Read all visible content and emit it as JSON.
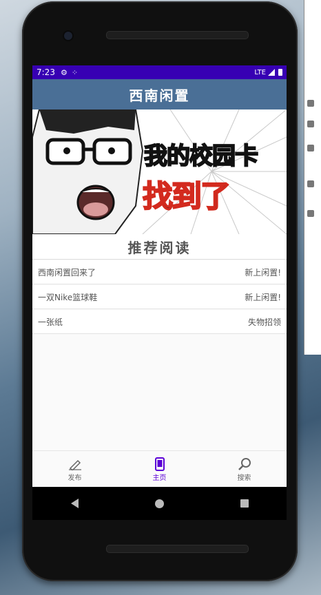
{
  "status_bar": {
    "time": "7:23",
    "network": "LTE"
  },
  "app_bar": {
    "title": "西南闲置"
  },
  "banner": {
    "line1": "我的校园卡",
    "line2": "找到了"
  },
  "section": {
    "title": "推荐阅读"
  },
  "items": [
    {
      "title": "西南闲置回来了",
      "tag": "新上闲置!"
    },
    {
      "title": "一双Nike篮球鞋",
      "tag": "新上闲置!"
    },
    {
      "title": "一张纸",
      "tag": "失物招领"
    }
  ],
  "bottom_nav": [
    {
      "label": "发布",
      "icon": "pen-icon",
      "active": false
    },
    {
      "label": "主页",
      "icon": "phone-icon",
      "active": true
    },
    {
      "label": "搜索",
      "icon": "search-icon",
      "active": false
    }
  ],
  "colors": {
    "status_bar": "#3700b3",
    "app_bar": "#4a6f96",
    "active_nav": "#5b00d6"
  }
}
